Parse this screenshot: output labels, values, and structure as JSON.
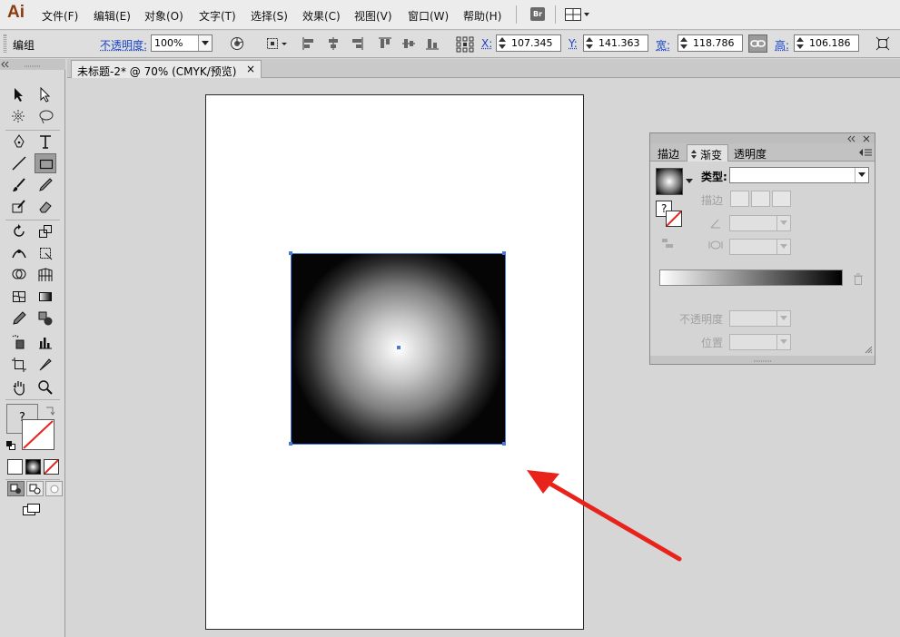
{
  "app": {
    "logo": "Ai"
  },
  "menu": [
    "文件(F)",
    "编辑(E)",
    "对象(O)",
    "文字(T)",
    "选择(S)",
    "效果(C)",
    "视图(V)",
    "窗口(W)",
    "帮助(H)"
  ],
  "bridge_badge": "Br",
  "control": {
    "selection_label": "编组",
    "opacity_label": "不透明度:",
    "opacity_value": "100%",
    "x_label": "X:",
    "x_value": "107.345",
    "y_label": "Y:",
    "y_value": "141.363",
    "w_label": "宽:",
    "w_value": "118.786",
    "h_label": "高:",
    "h_value": "106.186"
  },
  "document_tab": {
    "title": "未标题-2* @ 70% (CMYK/预览)",
    "close": "×"
  },
  "toolbar": {
    "fill_unknown": "?"
  },
  "gradient_panel": {
    "tabs": [
      "描边",
      "渐变",
      "透明度"
    ],
    "active_tab": "渐变",
    "type_label": "类型:",
    "type_value": "",
    "stroke_label": "描边",
    "unknown": "?",
    "opacity_label": "不透明度",
    "location_label": "位置"
  },
  "colors": {
    "selection": "#4a78d8",
    "arrow": "#e8231b",
    "logo": "#8a3b0f"
  }
}
